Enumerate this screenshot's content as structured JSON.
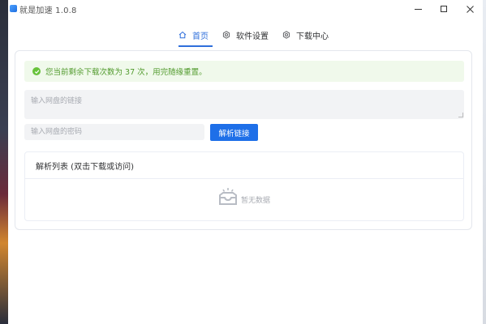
{
  "window": {
    "title": "就是加速 1.0.8",
    "controls": {
      "minimize": "minimize-icon",
      "maximize": "maximize-icon",
      "close": "close-icon"
    }
  },
  "tabs": [
    {
      "label": "首页",
      "icon": "home-icon",
      "active": true
    },
    {
      "label": "软件设置",
      "icon": "gear-icon",
      "active": false
    },
    {
      "label": "下载中心",
      "icon": "gear-icon",
      "active": false
    }
  ],
  "alert": {
    "text": "您当前剩余下载次数为 37 次，用完随缘重置。",
    "icon": "check-circle-icon"
  },
  "link_input": {
    "placeholder": "输入网盘的链接",
    "value": ""
  },
  "password_input": {
    "placeholder": "输入网盘的密码",
    "value": ""
  },
  "parse_button": {
    "label": "解析链接"
  },
  "list": {
    "title": "解析列表 (双击下载或访问)",
    "empty_text": "暂无数据",
    "empty_icon": "empty-inbox-icon"
  },
  "colors": {
    "accent": "#1e6fe8",
    "tab_active": "#2f6fdb",
    "success_bg": "#f0f9eb",
    "success_text": "#529b2e"
  }
}
